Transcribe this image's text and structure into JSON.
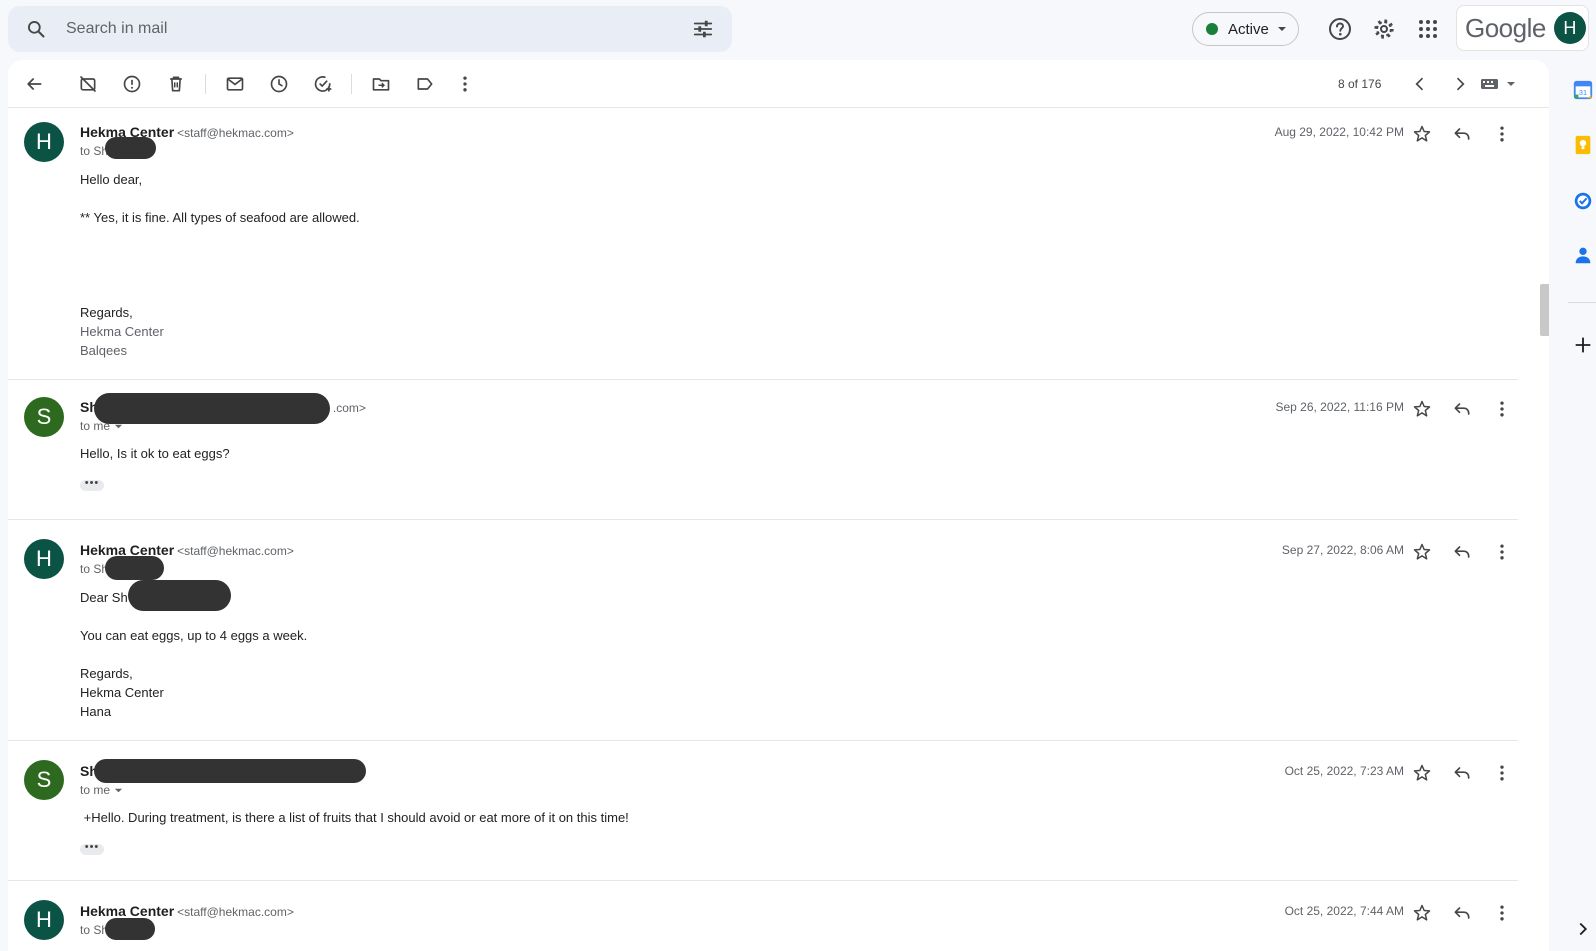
{
  "search": {
    "placeholder": "Search in mail"
  },
  "status": {
    "label": "Active",
    "dot_color": "#188038"
  },
  "google": {
    "wordmark": "Google",
    "avatar_letter": "H"
  },
  "toolbar": {
    "pager": "8 of 176"
  },
  "messages": [
    {
      "avatar_letter": "H",
      "avatar_color": "#0b5345",
      "sender": "Hekma Center",
      "email": "<staff@hekmac.com>",
      "to": "to Sh",
      "date": "Aug 29, 2022, 10:42 PM",
      "lines": [
        "Hello dear,",
        "",
        "** Yes, it is fine. All types of seafood are allowed.",
        "",
        "",
        "",
        "",
        "Regards,"
      ],
      "signature": [
        "Hekma Center",
        "Balqees"
      ]
    },
    {
      "avatar_letter": "S",
      "avatar_color": "#2d6a1f",
      "sender": "Sh",
      "email": ".com>",
      "to": "to me",
      "date": "Sep 26, 2022, 11:16 PM",
      "lines": [
        "Hello, Is it ok to eat eggs?"
      ],
      "more": "•••"
    },
    {
      "avatar_letter": "H",
      "avatar_color": "#0b5345",
      "sender": "Hekma Center",
      "email": "<staff@hekmac.com>",
      "to": "to Sh",
      "date": "Sep 27, 2022, 8:06 AM",
      "lines": [
        "Dear Sh",
        "",
        "You can eat eggs, up to 4 eggs a week.",
        "",
        "Regards,",
        "Hekma Center",
        "Hana"
      ]
    },
    {
      "avatar_letter": "S",
      "avatar_color": "#2d6a1f",
      "sender": "Sh",
      "email": "",
      "to": "to me",
      "date": "Oct 25, 2022, 7:23 AM",
      "lines": [
        " +Hello. During treatment, is there a list of fruits that I should avoid or eat more of it on this time!"
      ],
      "more": "•••"
    },
    {
      "avatar_letter": "H",
      "avatar_color": "#0b5345",
      "sender": "Hekma Center",
      "email": "<staff@hekmac.com>",
      "to": "to Sh",
      "date": "Oct 25, 2022, 7:44 AM",
      "lines": []
    }
  ]
}
